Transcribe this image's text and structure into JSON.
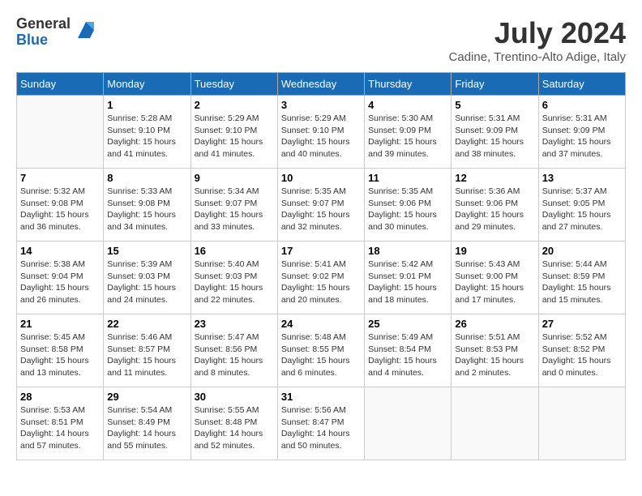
{
  "header": {
    "logo_general": "General",
    "logo_blue": "Blue",
    "month_year": "July 2024",
    "location": "Cadine, Trentino-Alto Adige, Italy"
  },
  "weekdays": [
    "Sunday",
    "Monday",
    "Tuesday",
    "Wednesday",
    "Thursday",
    "Friday",
    "Saturday"
  ],
  "weeks": [
    [
      {
        "day": "",
        "info": ""
      },
      {
        "day": "1",
        "info": "Sunrise: 5:28 AM\nSunset: 9:10 PM\nDaylight: 15 hours\nand 41 minutes."
      },
      {
        "day": "2",
        "info": "Sunrise: 5:29 AM\nSunset: 9:10 PM\nDaylight: 15 hours\nand 41 minutes."
      },
      {
        "day": "3",
        "info": "Sunrise: 5:29 AM\nSunset: 9:10 PM\nDaylight: 15 hours\nand 40 minutes."
      },
      {
        "day": "4",
        "info": "Sunrise: 5:30 AM\nSunset: 9:09 PM\nDaylight: 15 hours\nand 39 minutes."
      },
      {
        "day": "5",
        "info": "Sunrise: 5:31 AM\nSunset: 9:09 PM\nDaylight: 15 hours\nand 38 minutes."
      },
      {
        "day": "6",
        "info": "Sunrise: 5:31 AM\nSunset: 9:09 PM\nDaylight: 15 hours\nand 37 minutes."
      }
    ],
    [
      {
        "day": "7",
        "info": "Sunrise: 5:32 AM\nSunset: 9:08 PM\nDaylight: 15 hours\nand 36 minutes."
      },
      {
        "day": "8",
        "info": "Sunrise: 5:33 AM\nSunset: 9:08 PM\nDaylight: 15 hours\nand 34 minutes."
      },
      {
        "day": "9",
        "info": "Sunrise: 5:34 AM\nSunset: 9:07 PM\nDaylight: 15 hours\nand 33 minutes."
      },
      {
        "day": "10",
        "info": "Sunrise: 5:35 AM\nSunset: 9:07 PM\nDaylight: 15 hours\nand 32 minutes."
      },
      {
        "day": "11",
        "info": "Sunrise: 5:35 AM\nSunset: 9:06 PM\nDaylight: 15 hours\nand 30 minutes."
      },
      {
        "day": "12",
        "info": "Sunrise: 5:36 AM\nSunset: 9:06 PM\nDaylight: 15 hours\nand 29 minutes."
      },
      {
        "day": "13",
        "info": "Sunrise: 5:37 AM\nSunset: 9:05 PM\nDaylight: 15 hours\nand 27 minutes."
      }
    ],
    [
      {
        "day": "14",
        "info": "Sunrise: 5:38 AM\nSunset: 9:04 PM\nDaylight: 15 hours\nand 26 minutes."
      },
      {
        "day": "15",
        "info": "Sunrise: 5:39 AM\nSunset: 9:03 PM\nDaylight: 15 hours\nand 24 minutes."
      },
      {
        "day": "16",
        "info": "Sunrise: 5:40 AM\nSunset: 9:03 PM\nDaylight: 15 hours\nand 22 minutes."
      },
      {
        "day": "17",
        "info": "Sunrise: 5:41 AM\nSunset: 9:02 PM\nDaylight: 15 hours\nand 20 minutes."
      },
      {
        "day": "18",
        "info": "Sunrise: 5:42 AM\nSunset: 9:01 PM\nDaylight: 15 hours\nand 18 minutes."
      },
      {
        "day": "19",
        "info": "Sunrise: 5:43 AM\nSunset: 9:00 PM\nDaylight: 15 hours\nand 17 minutes."
      },
      {
        "day": "20",
        "info": "Sunrise: 5:44 AM\nSunset: 8:59 PM\nDaylight: 15 hours\nand 15 minutes."
      }
    ],
    [
      {
        "day": "21",
        "info": "Sunrise: 5:45 AM\nSunset: 8:58 PM\nDaylight: 15 hours\nand 13 minutes."
      },
      {
        "day": "22",
        "info": "Sunrise: 5:46 AM\nSunset: 8:57 PM\nDaylight: 15 hours\nand 11 minutes."
      },
      {
        "day": "23",
        "info": "Sunrise: 5:47 AM\nSunset: 8:56 PM\nDaylight: 15 hours\nand 8 minutes."
      },
      {
        "day": "24",
        "info": "Sunrise: 5:48 AM\nSunset: 8:55 PM\nDaylight: 15 hours\nand 6 minutes."
      },
      {
        "day": "25",
        "info": "Sunrise: 5:49 AM\nSunset: 8:54 PM\nDaylight: 15 hours\nand 4 minutes."
      },
      {
        "day": "26",
        "info": "Sunrise: 5:51 AM\nSunset: 8:53 PM\nDaylight: 15 hours\nand 2 minutes."
      },
      {
        "day": "27",
        "info": "Sunrise: 5:52 AM\nSunset: 8:52 PM\nDaylight: 15 hours\nand 0 minutes."
      }
    ],
    [
      {
        "day": "28",
        "info": "Sunrise: 5:53 AM\nSunset: 8:51 PM\nDaylight: 14 hours\nand 57 minutes."
      },
      {
        "day": "29",
        "info": "Sunrise: 5:54 AM\nSunset: 8:49 PM\nDaylight: 14 hours\nand 55 minutes."
      },
      {
        "day": "30",
        "info": "Sunrise: 5:55 AM\nSunset: 8:48 PM\nDaylight: 14 hours\nand 52 minutes."
      },
      {
        "day": "31",
        "info": "Sunrise: 5:56 AM\nSunset: 8:47 PM\nDaylight: 14 hours\nand 50 minutes."
      },
      {
        "day": "",
        "info": ""
      },
      {
        "day": "",
        "info": ""
      },
      {
        "day": "",
        "info": ""
      }
    ]
  ]
}
